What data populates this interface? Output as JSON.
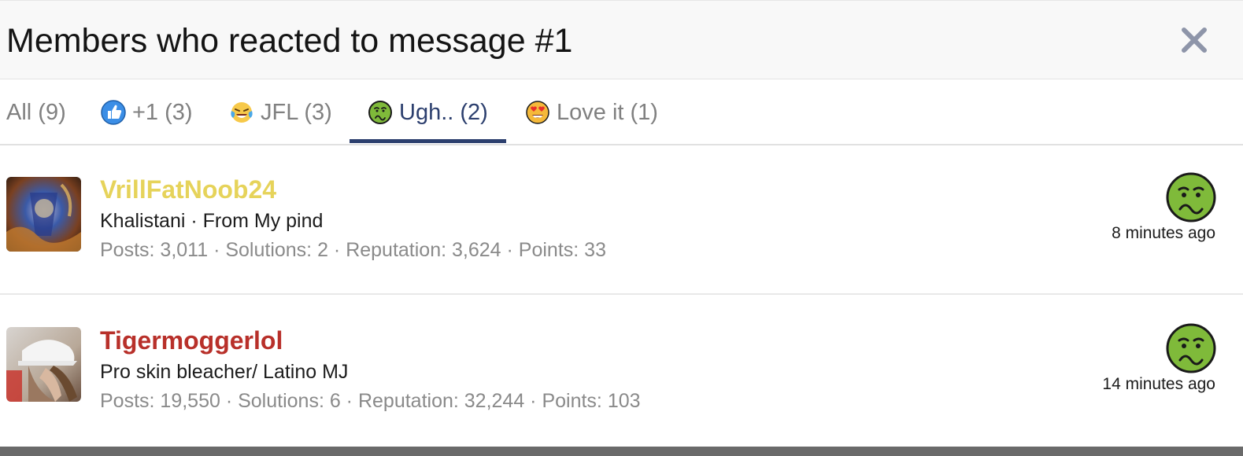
{
  "dialog": {
    "title": "Members who reacted to message #1",
    "close_icon": "close-icon"
  },
  "tabs": [
    {
      "label": "All (9)",
      "icon": null,
      "active": false
    },
    {
      "label": "+1 (3)",
      "icon": "thumbs-up-icon",
      "active": false
    },
    {
      "label": "JFL (3)",
      "icon": "laughing-crying-icon",
      "active": false
    },
    {
      "label": "Ugh.. (2)",
      "icon": "nauseated-face-icon",
      "active": true
    },
    {
      "label": "Love it (1)",
      "icon": "heart-eyes-icon",
      "active": false
    }
  ],
  "members": [
    {
      "username": "VrillFatNoob24",
      "username_color": "#e6d35a",
      "user_title": "Khalistani · From My pind",
      "stats": "Posts: 3,011 · Solutions: 2 · Reputation: 3,624 · Points: 33",
      "reaction_icon": "nauseated-face-icon",
      "time": "8 minutes ago"
    },
    {
      "username": "Tigermoggerlol",
      "username_color": "#b8302a",
      "user_title": "Pro skin bleacher/ Latino MJ",
      "stats": "Posts: 19,550 · Solutions: 6 · Reputation: 32,244 · Points: 103",
      "reaction_icon": "nauseated-face-icon",
      "time": "14 minutes ago"
    }
  ],
  "colors": {
    "active_tab": "#2c3f6e",
    "header_bg": "#f8f8f8",
    "muted_text": "#8a8a8a"
  }
}
